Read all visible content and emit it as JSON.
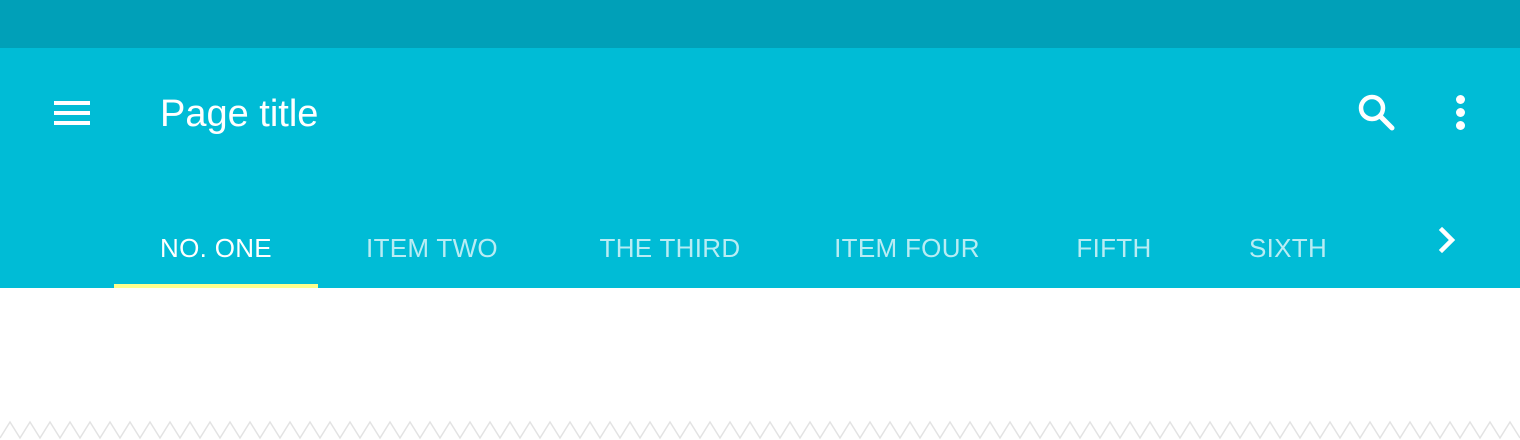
{
  "app_bar": {
    "title": "Page title",
    "menu_icon": "menu-icon",
    "search_icon": "search-icon",
    "more_icon": "more-vert-icon"
  },
  "tabs": [
    {
      "label": "NO. ONE",
      "active": true
    },
    {
      "label": "ITEM TWO",
      "active": false
    },
    {
      "label": "THE THIRD",
      "active": false
    },
    {
      "label": "ITEM FOUR",
      "active": false
    },
    {
      "label": "FIFTH",
      "active": false
    },
    {
      "label": "SIXTH",
      "active": false
    }
  ],
  "tab_scroll_icon": "chevron-right-icon",
  "colors": {
    "status_bar": "#00a0b8",
    "app_bar": "#00bcd6",
    "tab_indicator": "#ffff8d",
    "text": "#ffffff"
  }
}
